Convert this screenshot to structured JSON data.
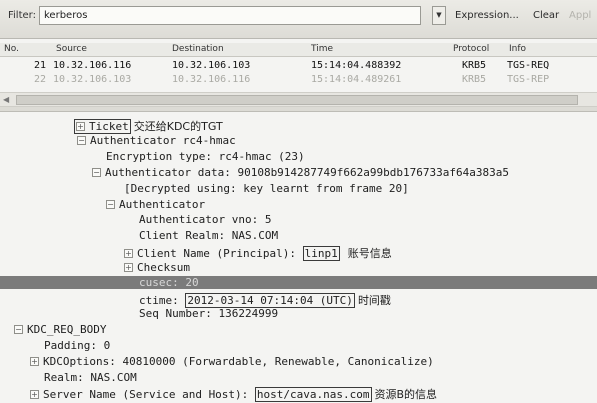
{
  "filter_bar": {
    "label": "Filter:",
    "value": "kerberos",
    "dropdown_icon": "triangle-down",
    "expression_label": "Expression...",
    "clear_label": "Clear",
    "apply_label": "Appl"
  },
  "packet_list": {
    "columns": {
      "no": "No.",
      "source": "Source",
      "destination": "Destination",
      "time": "Time",
      "protocol": "Protocol",
      "info": "Info"
    },
    "rows": [
      {
        "no": "21",
        "source": "10.32.106.116",
        "destination": "10.32.106.103",
        "time": "15:14:04.488392",
        "protocol": "KRB5",
        "info": "TGS-REQ"
      },
      {
        "no": "22",
        "source": "10.32.106.103",
        "destination": "10.32.106.116",
        "time": "15:14:04.489261",
        "protocol": "KRB5",
        "info": "TGS-REP"
      }
    ]
  },
  "details": {
    "ticket": "Ticket",
    "ticket_note": "交还给KDC的TGT",
    "authenticator_enc": "Authenticator rc4-hmac",
    "encryption_type": "Encryption type: rc4-hmac (23)",
    "authenticator_data": "Authenticator data: 90108b914287749f662a99bdb176733af64a383a5",
    "decrypted": "[Decrypted using: key learnt from frame 20]",
    "authenticator": "Authenticator",
    "auth_vno": "Authenticator vno: 5",
    "client_realm": "Client Realm: NAS.COM",
    "client_name_prefix": "Client Name (Principal): ",
    "client_name_value": "linp1",
    "client_name_note": "账号信息",
    "checksum": "Checksum",
    "cusec": "cusec: 20",
    "ctime_prefix": "ctime: ",
    "ctime_value": "2012-03-14 07:14:04 (UTC)",
    "ctime_note": "时间戳",
    "seq_number": "Seq Number: 136224999",
    "kdc_req_body": "KDC_REQ_BODY",
    "padding": "Padding: 0",
    "kdc_options": "KDCOptions: 40810000 (Forwardable, Renewable, Canonicalize)",
    "realm": "Realm: NAS.COM",
    "server_name_prefix": "Server Name (Service and Host): ",
    "server_name_value": "host/cava.nas.com",
    "server_name_note": "资源B的信息"
  }
}
